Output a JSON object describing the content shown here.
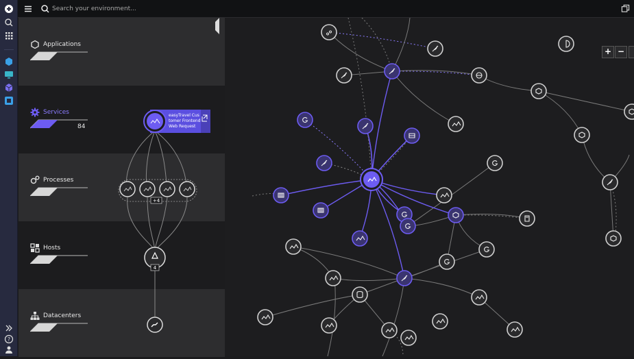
{
  "search": {
    "placeholder": "Search your environment..."
  },
  "tiers": [
    {
      "label": "Applications",
      "count": ""
    },
    {
      "label": "Services",
      "count": "84"
    },
    {
      "label": "Processes",
      "count": ""
    },
    {
      "label": "Hosts",
      "count": ""
    },
    {
      "label": "Datacenters",
      "count": ""
    }
  ],
  "stack": {
    "service_card": {
      "line1": "easyTravel Cus",
      "line2": "tomer Frontend",
      "line3": "Web Request"
    },
    "process_badge": "+4",
    "host_badge": "4"
  },
  "zoom": {
    "in": "+",
    "out": "−"
  },
  "colors": {
    "accent": "#5b4fe0",
    "nav": "#272a3f",
    "tier_active": "#6d5cf2"
  }
}
